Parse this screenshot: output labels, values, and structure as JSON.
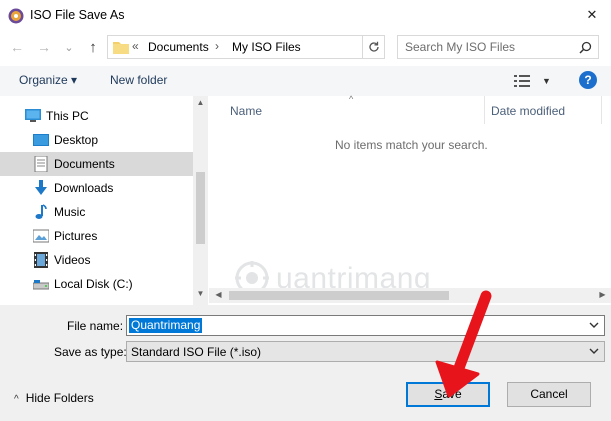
{
  "window": {
    "title": "ISO File Save As",
    "close_glyph": "✕",
    "app_icon": "disc-icon"
  },
  "nav": {
    "back_glyph": "←",
    "forward_glyph": "→",
    "recent_glyph": "⌄",
    "up_glyph": "↑",
    "breadcrumb_sep": "«",
    "breadcrumbs": [
      "Documents",
      "My ISO Files"
    ],
    "crumb_arrow": "›",
    "search_placeholder": "Search My ISO Files"
  },
  "toolbar": {
    "organize_label": "Organize ▾",
    "new_folder_label": "New folder",
    "help_label": "?"
  },
  "sidebar": {
    "items": [
      {
        "label": "This PC",
        "icon": "monitor-icon",
        "selected": false
      },
      {
        "label": "Desktop",
        "icon": "desktop-icon",
        "selected": false
      },
      {
        "label": "Documents",
        "icon": "documents-icon",
        "selected": true
      },
      {
        "label": "Downloads",
        "icon": "download-arrow-icon",
        "selected": false
      },
      {
        "label": "Music",
        "icon": "music-note-icon",
        "selected": false
      },
      {
        "label": "Pictures",
        "icon": "pictures-icon",
        "selected": false
      },
      {
        "label": "Videos",
        "icon": "film-icon",
        "selected": false
      },
      {
        "label": "Local Disk (C:)",
        "icon": "drive-icon",
        "selected": false
      }
    ]
  },
  "filelist": {
    "columns": [
      "Name",
      "Date modified"
    ],
    "empty_message": "No items match your search."
  },
  "watermark": {
    "text": "uantrimang"
  },
  "form": {
    "filename_label": "File name:",
    "filename_value": "Quantrimang",
    "savetype_label": "Save as type:",
    "savetype_value": "Standard ISO File (*.iso)"
  },
  "footer": {
    "hide_folders_label": "Hide Folders",
    "save_label_underlined": "S",
    "save_label_rest": "ave",
    "cancel_label": "Cancel"
  },
  "colors": {
    "accent": "#0078d7",
    "annotation_arrow": "#e8141c",
    "selected_bg": "#d9d9d9"
  }
}
